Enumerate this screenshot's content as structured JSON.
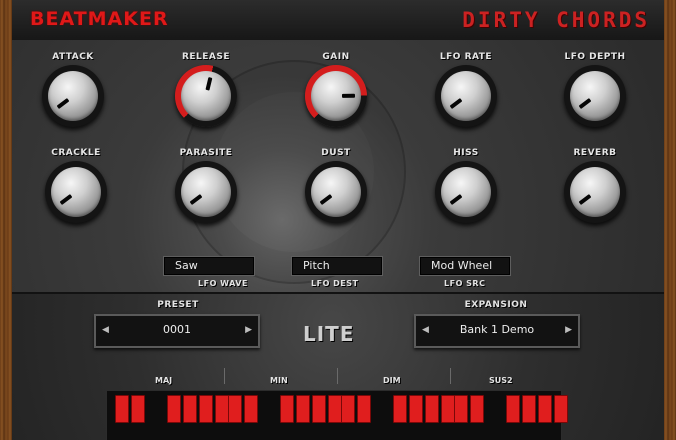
{
  "header": {
    "brand": "BEATMAKER",
    "product": "DIRTY CHORDS"
  },
  "knobs": [
    {
      "label": "ATTACK",
      "value": 0.03,
      "active": false
    },
    {
      "label": "RELEASE",
      "value": 0.55,
      "active": true
    },
    {
      "label": "GAIN",
      "value": 0.83,
      "active": true
    },
    {
      "label": "LFO RATE",
      "value": 0.03,
      "active": false
    },
    {
      "label": "LFO DEPTH",
      "value": 0.03,
      "active": false
    },
    {
      "label": "CRACKLE",
      "value": 0.03,
      "active": false
    },
    {
      "label": "PARASITE",
      "value": 0.03,
      "active": false
    },
    {
      "label": "DUST",
      "value": 0.03,
      "active": false
    },
    {
      "label": "HISS",
      "value": 0.03,
      "active": false
    },
    {
      "label": "REVERB",
      "value": 0.03,
      "active": false
    }
  ],
  "dropdowns": [
    {
      "label": "LFO WAVE",
      "value": "Saw"
    },
    {
      "label": "LFO DEST",
      "value": "Pitch"
    },
    {
      "label": "LFO SRC",
      "value": "Mod Wheel"
    }
  ],
  "preset": {
    "label": "PRESET",
    "value": "0001"
  },
  "expansion": {
    "label": "EXPANSION",
    "value": "Bank 1 Demo"
  },
  "edition": "LITE",
  "chord_types": [
    "MAJ",
    "MIN",
    "DIM",
    "SUS2"
  ],
  "key_count": 24,
  "colors": {
    "accent": "#e01818",
    "key": "#e01e1e",
    "panel": "#3b3b3b",
    "wood": "#6b3b16"
  }
}
